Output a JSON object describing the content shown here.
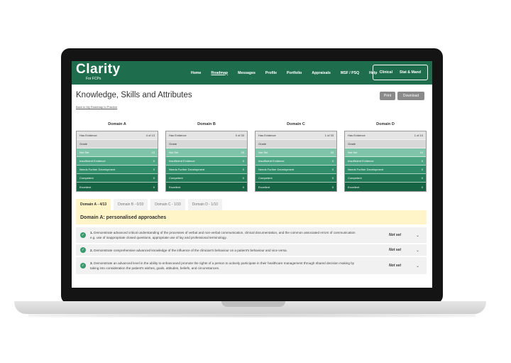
{
  "nav": {
    "logo_text": "Clarity",
    "logo_sub": "For FCPs",
    "links": [
      {
        "label": "Home"
      },
      {
        "label": "Roadmap"
      },
      {
        "label": "Messages"
      },
      {
        "label": "Profile"
      },
      {
        "label": "Portfolio"
      },
      {
        "label": "Appraisals"
      },
      {
        "label": "MSF / PSQ"
      },
      {
        "label": "Help"
      }
    ],
    "right_links": [
      {
        "label": "Clinical"
      },
      {
        "label": "Stat & Mand"
      }
    ]
  },
  "header": {
    "title": "Knowledge, Skills and Attributes",
    "back_link": "Back to My Roadmap to Practice",
    "print_label": "Print",
    "download_label": "Download"
  },
  "domains": [
    {
      "title": "Domain A",
      "rows": [
        {
          "label": "Has Evidence",
          "value": "4 of 13"
        },
        {
          "label": "Grade",
          "value": ""
        },
        {
          "label": "Not Set",
          "value": "13"
        },
        {
          "label": "Insufficient Evidence",
          "value": "0"
        },
        {
          "label": "Needs Further Development",
          "value": "0"
        },
        {
          "label": "Competent",
          "value": "0"
        },
        {
          "label": "Excellent",
          "value": "0"
        }
      ]
    },
    {
      "title": "Domain B",
      "rows": [
        {
          "label": "Has Evidence",
          "value": "0 of 33"
        },
        {
          "label": "Grade",
          "value": ""
        },
        {
          "label": "Not Set",
          "value": "33"
        },
        {
          "label": "Insufficient Evidence",
          "value": "0"
        },
        {
          "label": "Needs Further Development",
          "value": "0"
        },
        {
          "label": "Competent",
          "value": "0"
        },
        {
          "label": "Excellent",
          "value": "0"
        }
      ]
    },
    {
      "title": "Domain C",
      "rows": [
        {
          "label": "Has Evidence",
          "value": "1 of 33"
        },
        {
          "label": "Grade",
          "value": ""
        },
        {
          "label": "Not Set",
          "value": "33"
        },
        {
          "label": "Insufficient Evidence",
          "value": "0"
        },
        {
          "label": "Needs Further Development",
          "value": "0"
        },
        {
          "label": "Competent",
          "value": "0"
        },
        {
          "label": "Excellent",
          "value": "0"
        }
      ]
    },
    {
      "title": "Domain D",
      "rows": [
        {
          "label": "Has Evidence",
          "value": "1 of 10"
        },
        {
          "label": "Grade",
          "value": ""
        },
        {
          "label": "Not Set",
          "value": "10"
        },
        {
          "label": "Insufficient Evidence",
          "value": "0"
        },
        {
          "label": "Needs Further Development",
          "value": "0"
        },
        {
          "label": "Competent",
          "value": "0"
        },
        {
          "label": "Excellent",
          "value": "0"
        }
      ]
    }
  ],
  "tabs": [
    {
      "label": "Domain A - 4/13"
    },
    {
      "label": "Domain B - 0/33"
    },
    {
      "label": "Domain C - 1/33"
    },
    {
      "label": "Domain D - 1/10"
    }
  ],
  "domain_header": "Domain A: personalised approaches",
  "items": [
    {
      "number": "1.",
      "text": "Demonstrate advanced critical understanding of the processes of verbal and non-verbal communication, clinical documentation, and the common associated errors of communication e.g. use of inappropriate closed questions, appropriate use of lay and professional terminology.",
      "status": "Not set"
    },
    {
      "number": "2.",
      "text": "Demonstrate comprehensive advanced knowledge of the influence of the clinician's behaviour on a patient's behaviour and vice versa.",
      "status": "Not set"
    },
    {
      "number": "3.",
      "text": "Demonstrate an advanced level in the ability to enhanceand promote the rights of a person to actively participate in their healthcare management through shared decision making by taking into consideration the patient's wishes, goals, attitudes, beliefs, and circumstances.",
      "status": "Not set"
    }
  ]
}
